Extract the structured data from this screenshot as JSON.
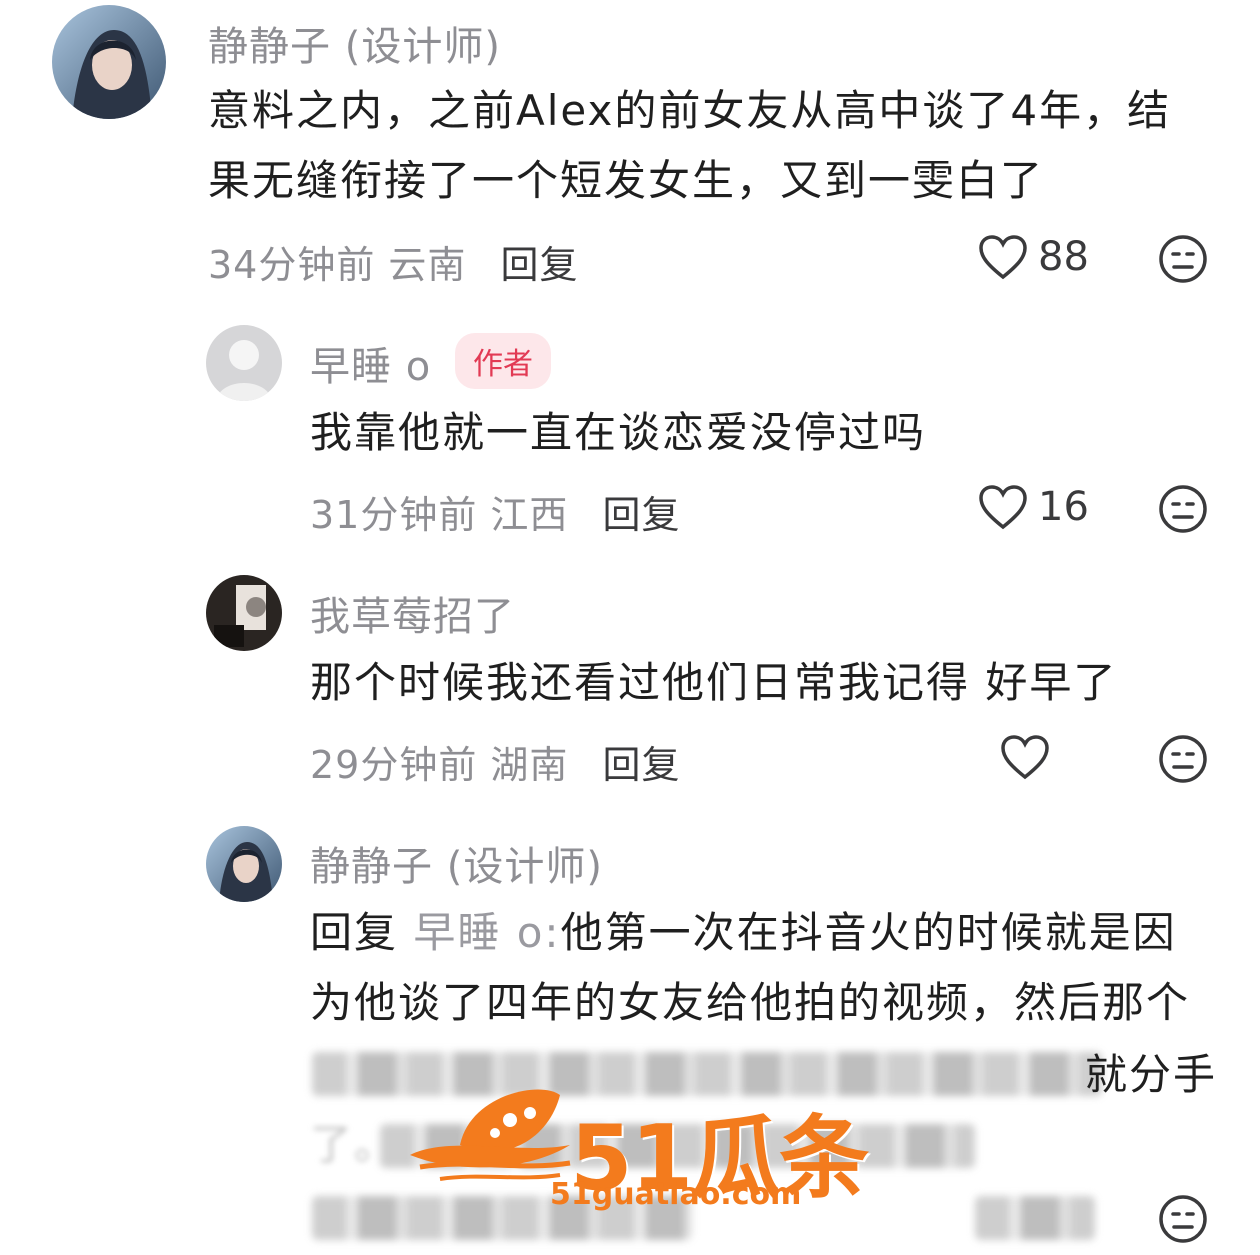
{
  "comments": [
    {
      "username": "静静子 (设计师)",
      "text": "意料之内，之前Alex的前女友从高中谈了4年，结果无缝衔接了一个短发女生，又到一雯白了",
      "time_location": "34分钟前 云南",
      "reply_label": "回复",
      "likes": "88"
    },
    {
      "username": "早睡 o",
      "badge": "作者",
      "text": "我靠他就一直在谈恋爱没停过吗",
      "time_location": "31分钟前 江西",
      "reply_label": "回复",
      "likes": "16"
    },
    {
      "username": "我草莓招了",
      "text": "那个时候我还看过他们日常我记得 好早了",
      "time_location": "29分钟前 湖南",
      "reply_label": "回复",
      "likes": ""
    },
    {
      "username": "静静子 (设计师)",
      "reply_prefix": "回复",
      "reply_target": "早睡 o:",
      "text": "他第一次在抖音火的时候就是因为他谈了四年的女友给他拍的视频，然后那个",
      "visible_fragment": "就分手",
      "blurred_line2_start": "了。"
    }
  ],
  "watermark": {
    "brand": "51瓜条",
    "url": "51guatiao.com"
  },
  "colors": {
    "username": "#8e8e93",
    "author_badge_bg": "#fde7ea",
    "author_badge_text": "#e23a54",
    "watermark": "#f37b1d"
  },
  "icons": [
    "heart-outline-icon",
    "neutral-face-icon"
  ]
}
